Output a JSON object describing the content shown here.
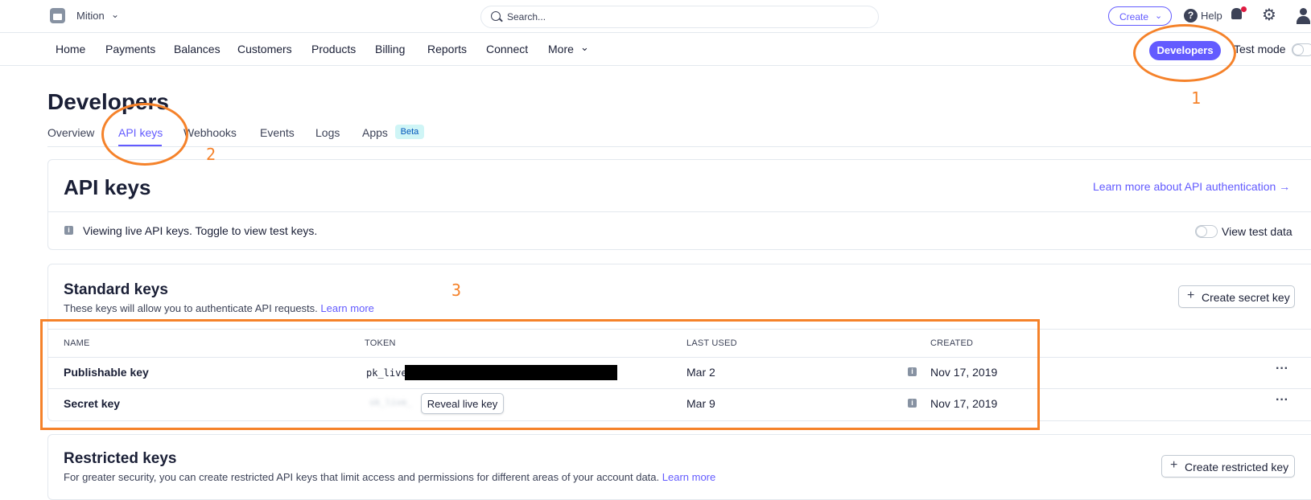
{
  "topbar": {
    "account_name": "Mition",
    "search_placeholder": "Search...",
    "create_label": "Create",
    "help_label": "Help"
  },
  "nav": {
    "items": [
      "Home",
      "Payments",
      "Balances",
      "Customers",
      "Products",
      "Billing",
      "Reports",
      "Connect",
      "More"
    ],
    "developers_label": "Developers",
    "test_mode_label": "Test mode"
  },
  "page": {
    "title": "Developers",
    "tabs": [
      "Overview",
      "API keys",
      "Webhooks",
      "Events",
      "Logs",
      "Apps"
    ],
    "active_tab": "API keys",
    "apps_badge": "Beta"
  },
  "api_card": {
    "title": "API keys",
    "learn_more": "Learn more about API authentication →",
    "info_text": "Viewing live API keys. Toggle to view test keys.",
    "view_test_data_label": "View test data",
    "view_test_data_on": false
  },
  "standard_keys": {
    "title": "Standard keys",
    "description": "These keys will allow you to authenticate API requests.",
    "learn_more": "Learn more",
    "create_button": "Create secret key",
    "columns": [
      "NAME",
      "TOKEN",
      "LAST USED",
      "CREATED"
    ],
    "rows": [
      {
        "name": "Publishable key",
        "token": "pk_live_",
        "last_used": "Mar 2",
        "created": "Nov 17, 2019"
      },
      {
        "name": "Secret key",
        "token": "sk_live_",
        "last_used": "Mar 9",
        "created": "Nov 17, 2019",
        "reveal_label": "Reveal live key"
      }
    ]
  },
  "restricted_keys": {
    "title": "Restricted keys",
    "description": "For greater security, you can create restricted API keys that limit access and permissions for different areas of your account data.",
    "learn_more": "Learn more",
    "create_button": "Create restricted key"
  },
  "annotations": {
    "labels": [
      "1",
      "2",
      "3"
    ],
    "color": "#f5822a"
  },
  "colors": {
    "accent": "#635bff",
    "text": "#1a1f36",
    "border": "#e3e8ee"
  }
}
